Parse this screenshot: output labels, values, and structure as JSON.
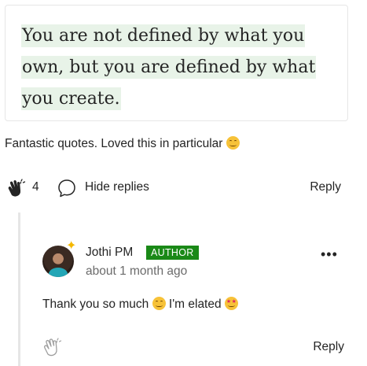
{
  "quote": {
    "line1": "You are not defined by what you",
    "line2": "own, but you are defined by what",
    "line3": "you create."
  },
  "comment": {
    "text": "Fantastic quotes. Loved this in particular",
    "emoji": "smiling-face-emoji",
    "clap_count": "4",
    "hide_replies_label": "Hide replies",
    "reply_label": "Reply"
  },
  "reply": {
    "author": "Jothi PM",
    "badge": "AUTHOR",
    "time": "about 1 month ago",
    "text_part1": "Thank you so much",
    "text_part2": "I'm elated",
    "reply_label": "Reply",
    "more_label": "•••"
  },
  "colors": {
    "highlight": "#e8f3e8",
    "author_badge": "#1a8917",
    "muted_text": "#6b6b6b"
  }
}
